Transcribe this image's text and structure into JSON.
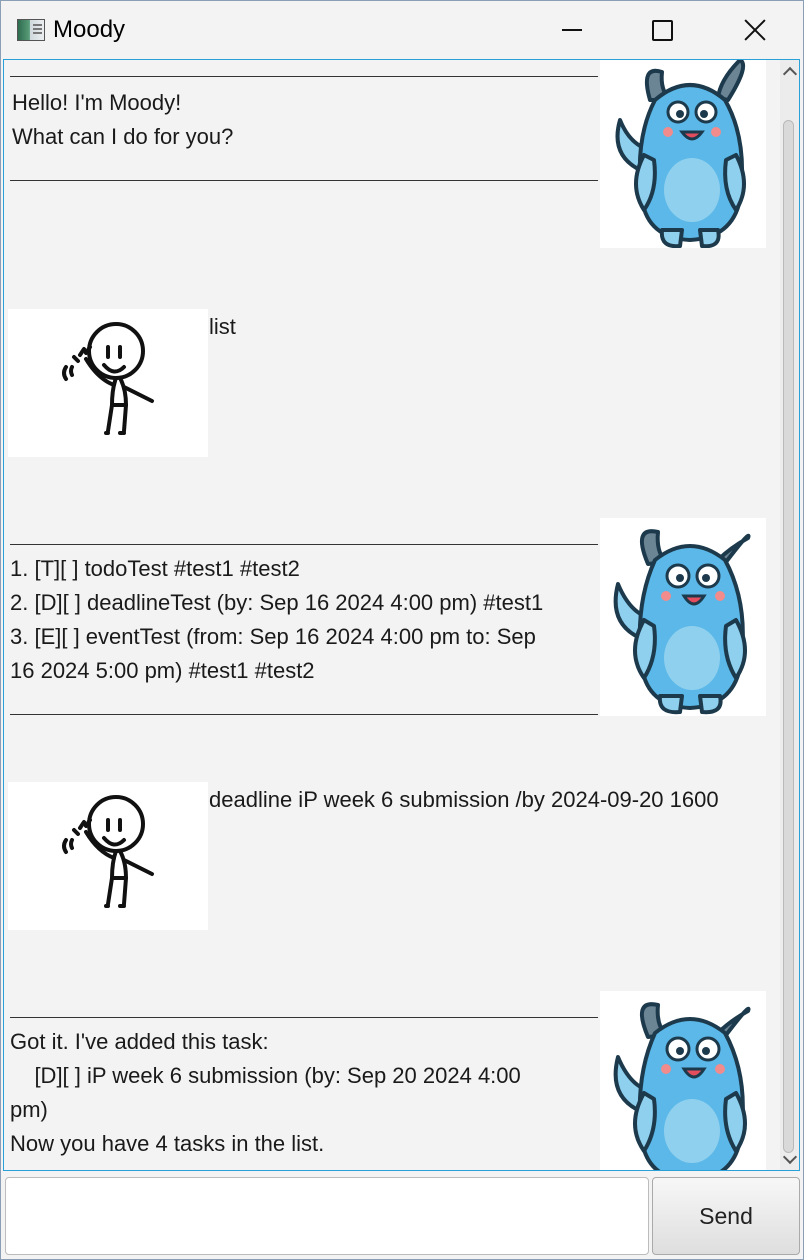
{
  "window": {
    "title": "Moody",
    "icon": "app-window-icon",
    "controls": [
      "minimize-icon",
      "maximize-icon",
      "close-icon"
    ]
  },
  "messages": [
    {
      "speaker": "bot",
      "avatar": "blue-monster-avatar",
      "lines": [
        "Hello! I'm Moody!",
        "What can I do for you?"
      ]
    },
    {
      "speaker": "user",
      "avatar": "stick-figure-avatar",
      "lines": [
        "list"
      ]
    },
    {
      "speaker": "bot",
      "avatar": "blue-monster-avatar",
      "lines": [
        "1. [T][ ] todoTest #test1 #test2",
        "2. [D][ ] deadlineTest (by: Sep 16 2024 4:00 pm) #test1",
        "3. [E][ ] eventTest (from: Sep 16 2024 4:00 pm to: Sep",
        "16 2024 5:00 pm) #test1 #test2"
      ]
    },
    {
      "speaker": "user",
      "avatar": "stick-figure-avatar",
      "lines": [
        "deadline iP week 6 submission /by 2024-09-20 1600"
      ]
    },
    {
      "speaker": "bot",
      "avatar": "blue-monster-avatar",
      "lines": [
        "Got it. I've added this task:",
        "    [D][ ] iP week 6 submission (by: Sep 20 2024 4:00",
        "pm)",
        "Now you have 4 tasks in the list."
      ]
    }
  ],
  "input": {
    "value": "",
    "placeholder": ""
  },
  "send_button": {
    "label": "Send"
  },
  "colors": {
    "background": "#f3f3f3",
    "chat_border": "#2aa0d8",
    "monster_blue": "#5bb8e8"
  }
}
